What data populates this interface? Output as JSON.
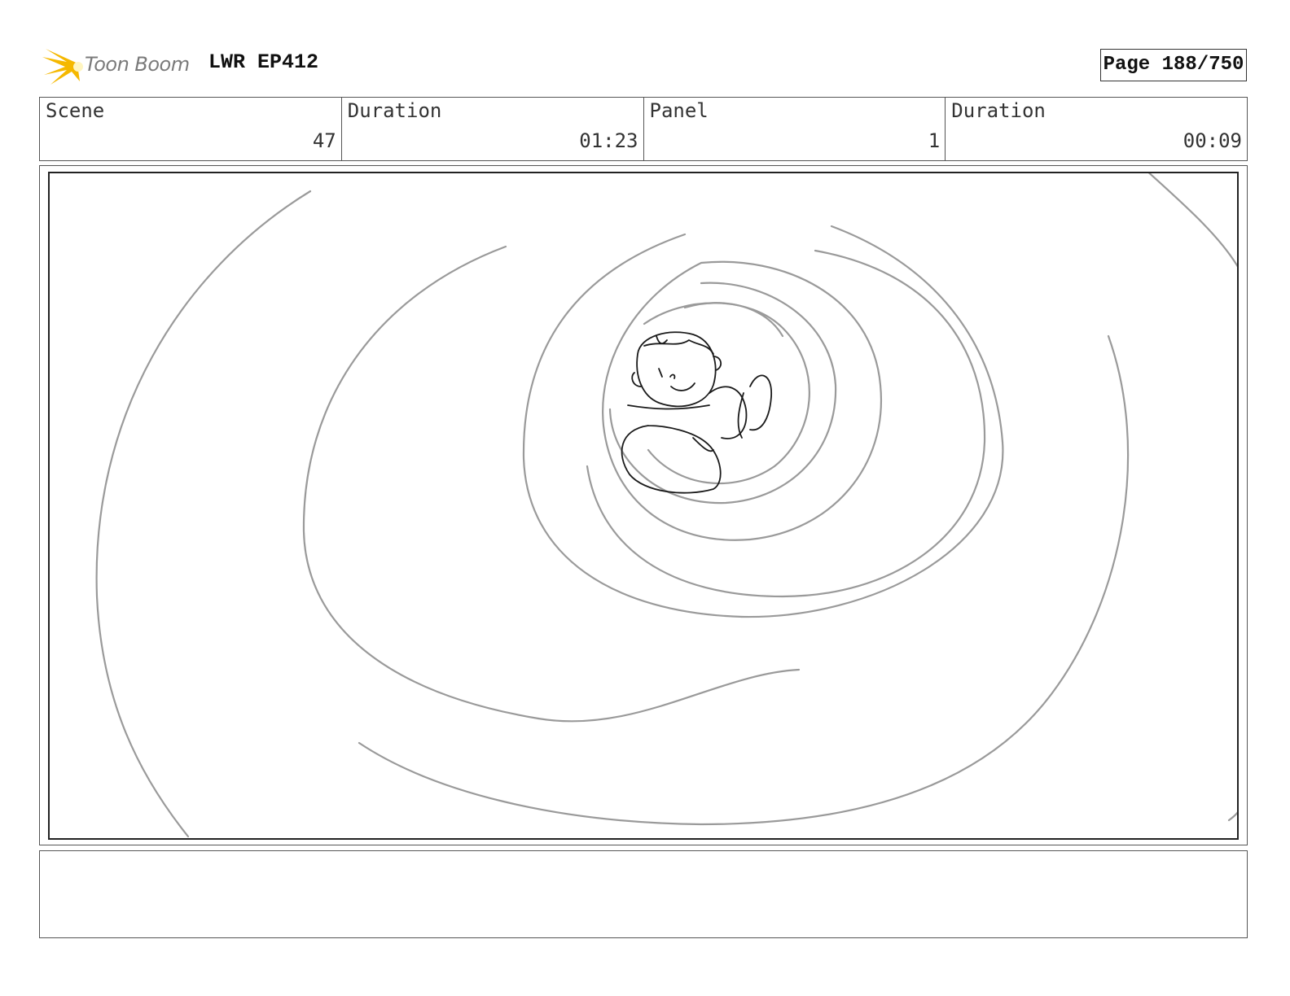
{
  "header": {
    "logo_text": "Toon Boom",
    "project_title": "LWR EP412",
    "page_label": "Page 188/750"
  },
  "info": [
    {
      "label": "Scene",
      "value": "47"
    },
    {
      "label": "Duration",
      "value": "01:23"
    },
    {
      "label": "Panel",
      "value": "1"
    },
    {
      "label": "Duration",
      "value": "00:09"
    }
  ],
  "colors": {
    "logo_burst": "#f5b800",
    "sketch_gray": "#9a9a9a",
    "sketch_dark": "#1a1a1a"
  },
  "notes": {
    "text": ""
  }
}
